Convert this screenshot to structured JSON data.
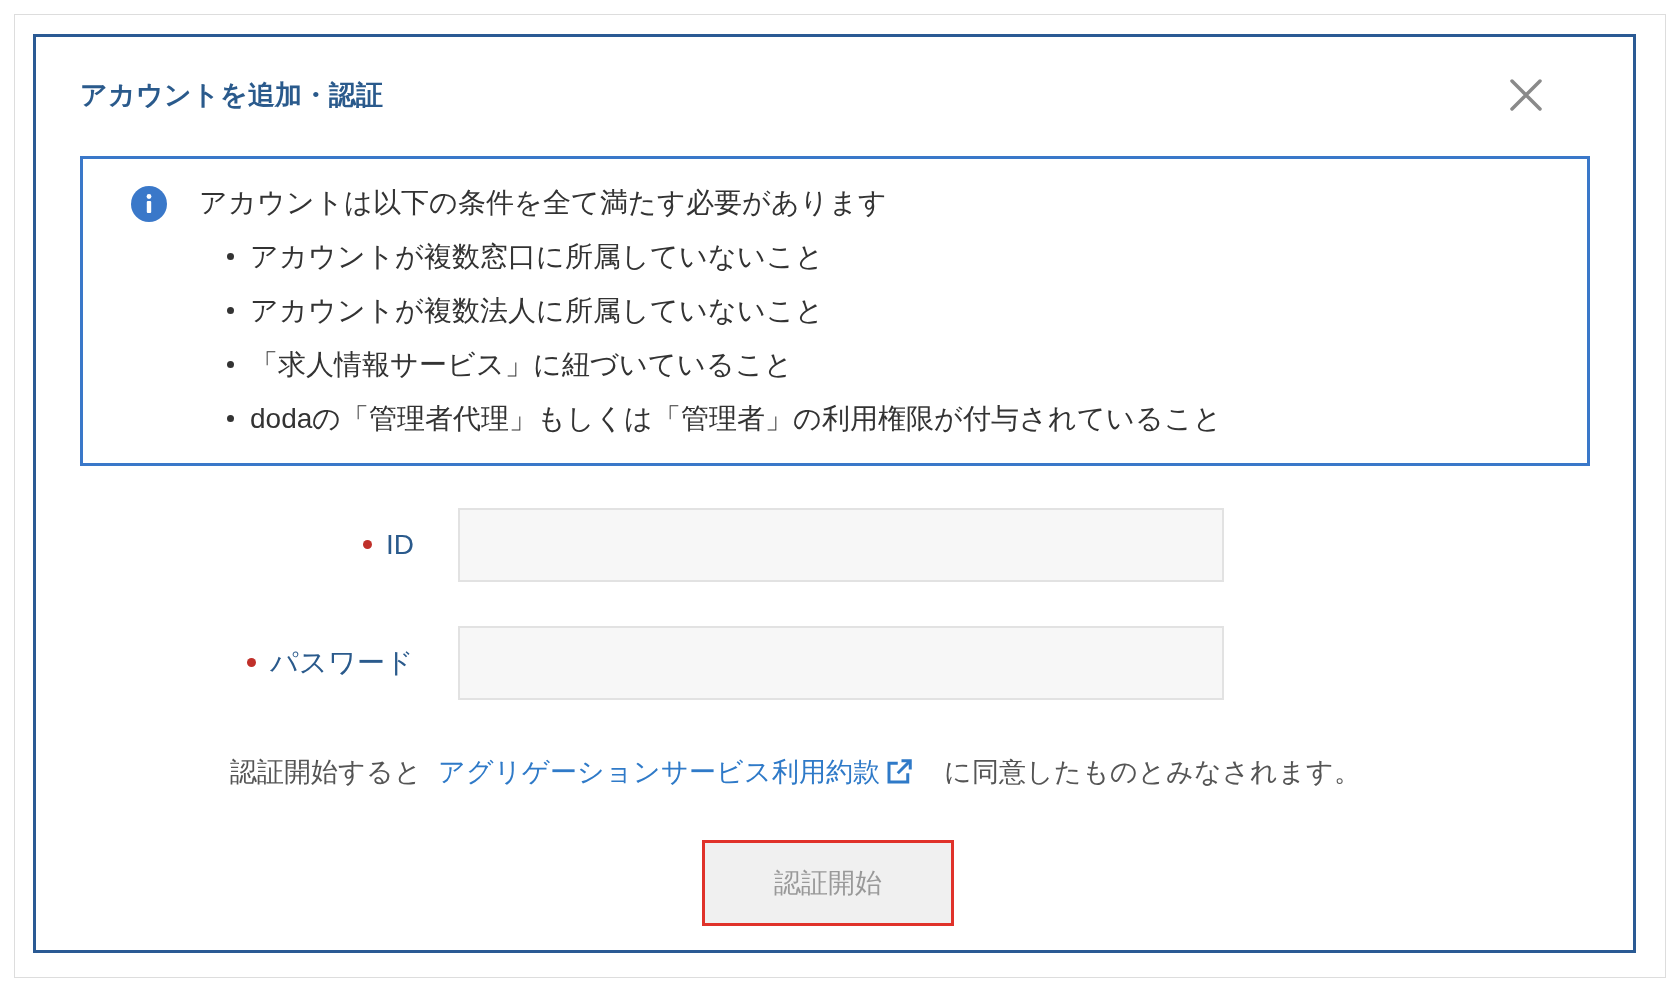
{
  "dialog": {
    "title": "アカウントを追加・認証"
  },
  "notice": {
    "heading": "アカウントは以下の条件を全て満たす必要があります",
    "items": [
      "アカウントが複数窓口に所属していないこと",
      "アカウントが複数法人に所属していないこと",
      "「求人情報サービス」に紐づいていること",
      "dodaの「管理者代理」もしくは「管理者」の利用権限が付与されていること"
    ]
  },
  "fields": [
    {
      "label": "ID",
      "required": true
    },
    {
      "label": "パスワード",
      "required": true
    }
  ],
  "terms": {
    "before": "認証開始すると",
    "link": "アグリゲーションサービス利用約款",
    "after": "に同意したものとみなされます。"
  },
  "submit": {
    "label": "認証開始",
    "disabled": true,
    "highlighted": true
  }
}
